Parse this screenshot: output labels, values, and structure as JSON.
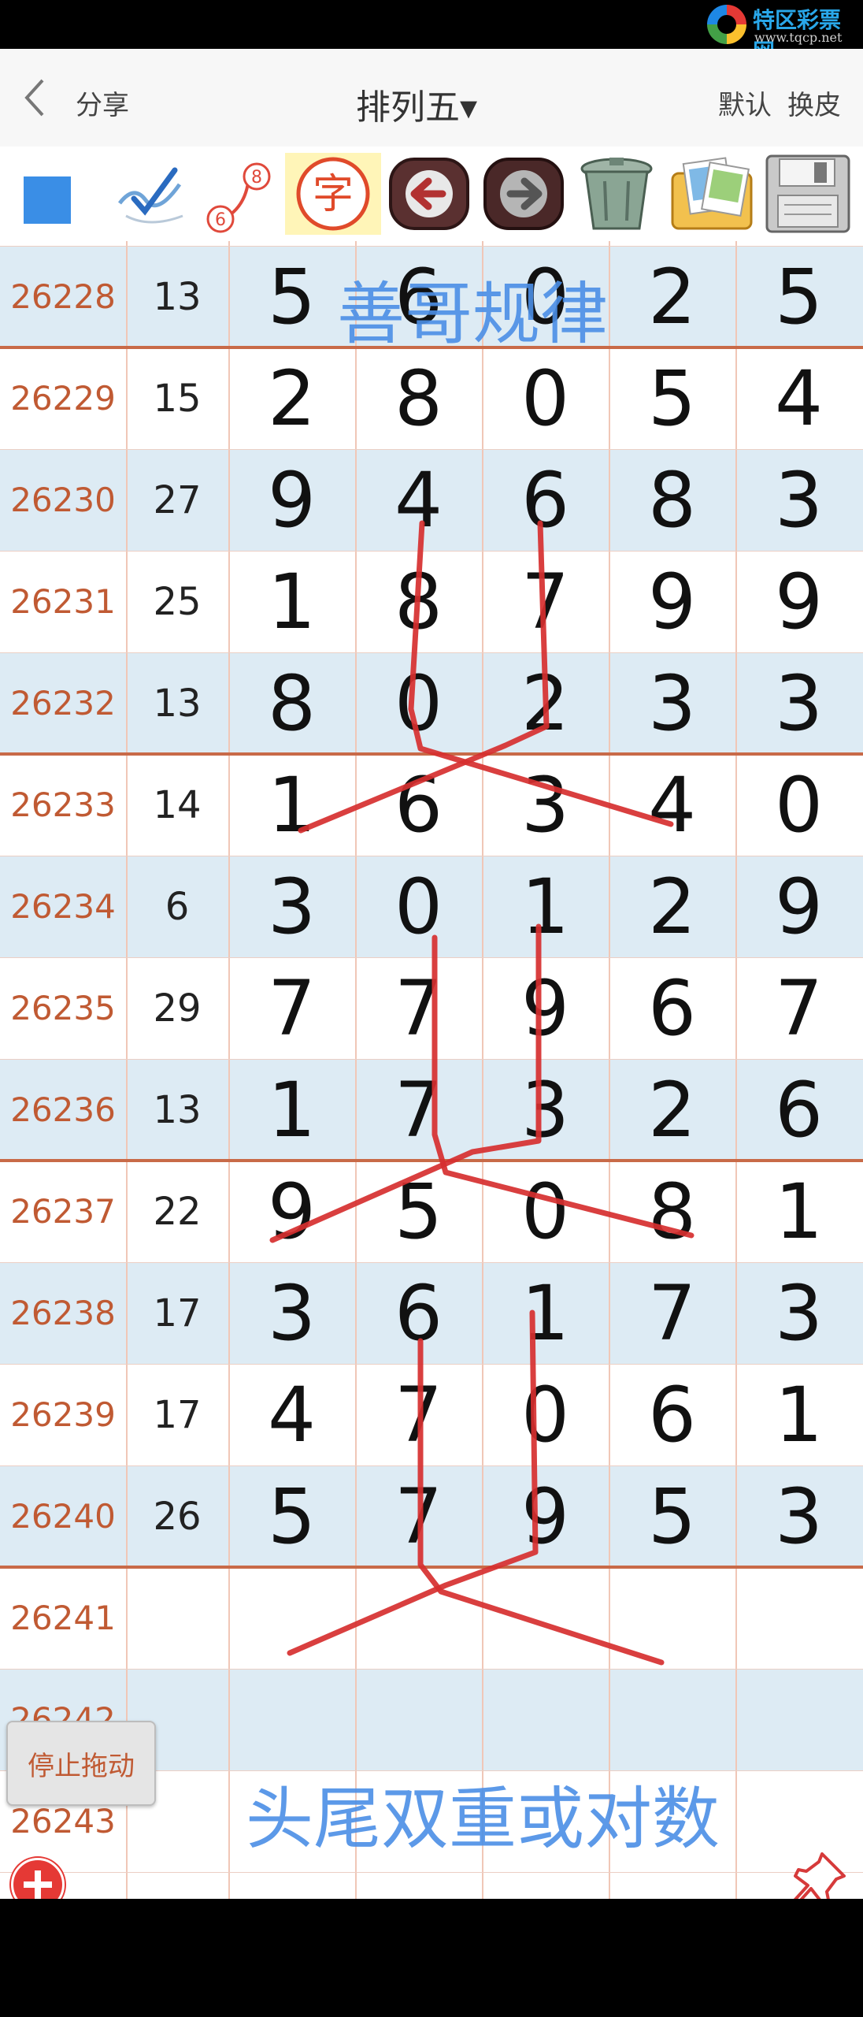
{
  "logo": {
    "name": "特区彩票网",
    "url": "www.tqcp.net"
  },
  "header": {
    "back_icon": "chevron-left-icon",
    "share_label": "分享",
    "title": "排列五▾",
    "default_label": "默认",
    "skin_label": "换皮"
  },
  "toolbar": {
    "tools": [
      {
        "name": "color-square-icon",
        "color": "#3a8ee6"
      },
      {
        "name": "pen-check-icon"
      },
      {
        "name": "number-link-icon",
        "text_a": "8",
        "text_b": "6"
      },
      {
        "name": "char-icon",
        "text": "字"
      },
      {
        "name": "undo-arrow-icon"
      },
      {
        "name": "redo-arrow-icon"
      },
      {
        "name": "trash-icon"
      },
      {
        "name": "photos-icon"
      },
      {
        "name": "save-disk-icon"
      }
    ]
  },
  "rows": [
    {
      "issue": "26228",
      "sum": "13",
      "digits": [
        "5",
        "6",
        "0",
        "2",
        "5"
      ]
    },
    {
      "issue": "26229",
      "sum": "15",
      "digits": [
        "2",
        "8",
        "0",
        "5",
        "4"
      ]
    },
    {
      "issue": "26230",
      "sum": "27",
      "digits": [
        "9",
        "4",
        "6",
        "8",
        "3"
      ]
    },
    {
      "issue": "26231",
      "sum": "25",
      "digits": [
        "1",
        "8",
        "7",
        "9",
        "9"
      ]
    },
    {
      "issue": "26232",
      "sum": "13",
      "digits": [
        "8",
        "0",
        "2",
        "3",
        "3"
      ]
    },
    {
      "issue": "26233",
      "sum": "14",
      "digits": [
        "1",
        "6",
        "3",
        "4",
        "0"
      ]
    },
    {
      "issue": "26234",
      "sum": "6",
      "digits": [
        "3",
        "0",
        "1",
        "2",
        "9"
      ]
    },
    {
      "issue": "26235",
      "sum": "29",
      "digits": [
        "7",
        "7",
        "9",
        "6",
        "7"
      ]
    },
    {
      "issue": "26236",
      "sum": "13",
      "digits": [
        "1",
        "7",
        "3",
        "2",
        "6"
      ]
    },
    {
      "issue": "26237",
      "sum": "22",
      "digits": [
        "9",
        "5",
        "0",
        "8",
        "1"
      ]
    },
    {
      "issue": "26238",
      "sum": "17",
      "digits": [
        "3",
        "6",
        "1",
        "7",
        "3"
      ]
    },
    {
      "issue": "26239",
      "sum": "17",
      "digits": [
        "4",
        "7",
        "0",
        "6",
        "1"
      ]
    },
    {
      "issue": "26240",
      "sum": "26",
      "digits": [
        "5",
        "7",
        "9",
        "5",
        "3"
      ]
    },
    {
      "issue": "26241",
      "sum": "",
      "digits": [
        "",
        "",
        "",
        "",
        ""
      ]
    },
    {
      "issue": "26242",
      "sum": "",
      "digits": [
        "",
        "",
        "",
        "",
        ""
      ]
    },
    {
      "issue": "26243",
      "sum": "",
      "digits": [
        "",
        "",
        "",
        "",
        ""
      ]
    }
  ],
  "overlay": {
    "caption_top": "善哥规律",
    "caption_bottom": "头尾双重或对数",
    "stop_drag_label": "停止拖动",
    "add_icon": "plus-circle-icon",
    "pin_icon": "pin-icon",
    "stroke_color": "#d62f2f",
    "caption_color": "#4b8fe6"
  }
}
